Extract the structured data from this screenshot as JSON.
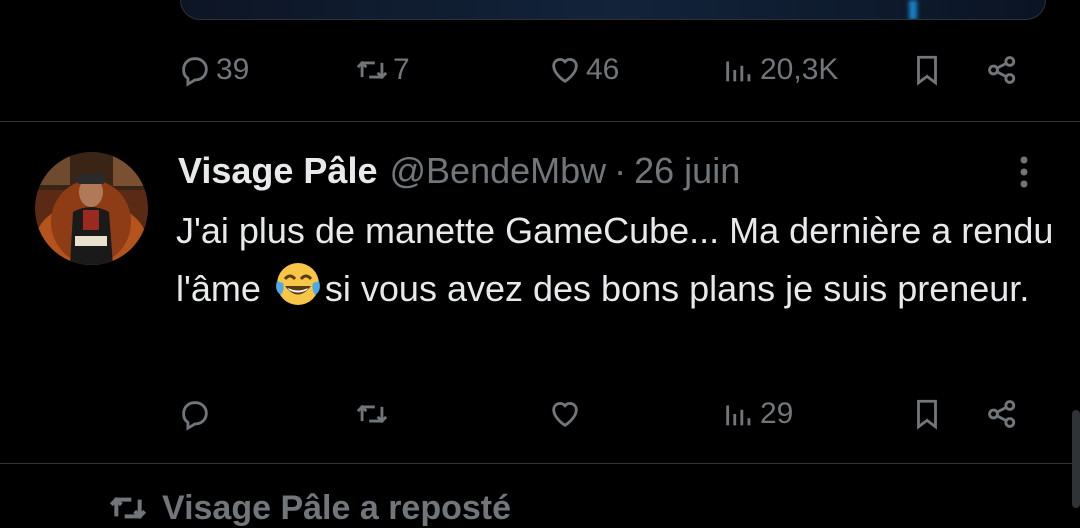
{
  "prev_tweet": {
    "actions": {
      "replies": "39",
      "reposts": "7",
      "likes": "46",
      "views": "20,3K"
    }
  },
  "tweet": {
    "author_name": "Visage Pâle",
    "handle": "@BendeMbw",
    "separator": "·",
    "date": "26 juin",
    "text_part1": "J'ai plus de manette GameCube... Ma dernière a rendu l'âme ",
    "emoji": "face-with-tears-of-joy",
    "text_part2": "si vous avez des bons plans je suis preneur.",
    "actions": {
      "views": "29"
    }
  },
  "next_item": {
    "repost_label": "Visage Pâle a reposté"
  },
  "colors": {
    "background": "#000000",
    "text": "#e7e9ea",
    "muted": "#71767b",
    "divider": "#2f3336",
    "accent": "#1d9bf0",
    "emoji": "#f7c646"
  }
}
